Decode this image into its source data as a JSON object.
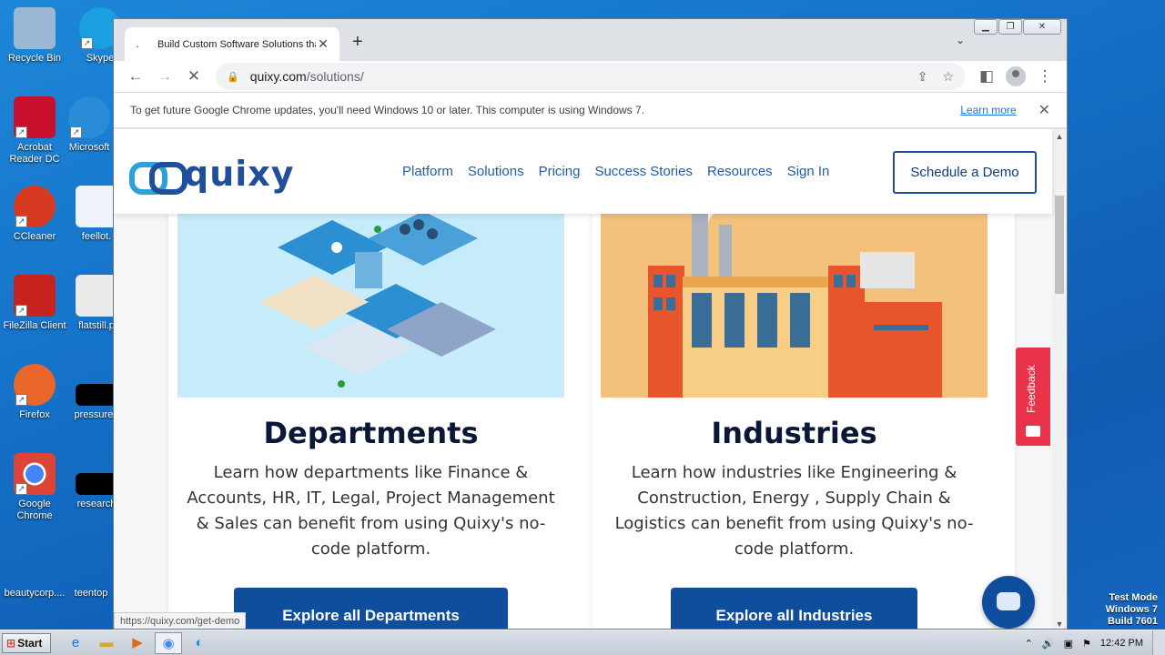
{
  "desktop": {
    "icons": [
      {
        "label": "Recycle Bin",
        "color": "#9bb7d4",
        "glyph": "🗑"
      },
      {
        "label": "Skype",
        "color": "#1a9fe0",
        "glyph": "S"
      },
      {
        "label": "Acrobat Reader DC",
        "color": "#c8102e",
        "glyph": "A"
      },
      {
        "label": "Microsoft",
        "color": "#2a8bd6",
        "glyph": "e"
      },
      {
        "label": "CCleaner",
        "color": "#d63b22",
        "glyph": "C"
      },
      {
        "label": "feellot.",
        "color": "#eef3fb",
        "glyph": "W"
      },
      {
        "label": "FileZilla Client",
        "color": "#c8221e",
        "glyph": "FZ"
      },
      {
        "label": "flatstill.p",
        "color": "#eaeaea",
        "glyph": ""
      },
      {
        "label": "Firefox",
        "color": "#e8662a",
        "glyph": "🦊"
      },
      {
        "label": "pressureb",
        "color": "#000000",
        "glyph": ""
      },
      {
        "label": "Google Chrome",
        "color": "#4285f4",
        "glyph": "◉"
      },
      {
        "label": "research",
        "color": "#000000",
        "glyph": ""
      },
      {
        "label": "beautycorp....",
        "color": "#1c6ec5",
        "glyph": ""
      },
      {
        "label": "teentop",
        "color": "#1c6ec5",
        "glyph": ""
      }
    ],
    "watermark": {
      "line1": "Test Mode",
      "line2": "Windows 7",
      "line3": "Build 7601"
    }
  },
  "browser": {
    "tab_title": "Build Custom Software Solutions tha",
    "new_tab": "+",
    "url_host": "quixy.com",
    "url_path": "/solutions/",
    "infobar": {
      "message": "To get future Google Chrome updates, you'll need Windows 10 or later. This computer is using Windows 7.",
      "link": "Learn more"
    },
    "status_url": "https://quixy.com/get-demo"
  },
  "site": {
    "logo": "quixy",
    "nav": [
      "Platform",
      "Solutions",
      "Pricing",
      "Success Stories",
      "Resources",
      "Sign In"
    ],
    "cta": "Schedule a Demo",
    "cards": [
      {
        "title": "Departments",
        "body": "Learn how departments like Finance & Accounts, HR, IT, Legal, Project Management & Sales can benefit from using Quixy's no-code platform.",
        "button": "Explore all Departments"
      },
      {
        "title": "Industries",
        "body": "Learn how industries like Engineering & Construction, Energy , Supply Chain & Logistics can benefit from using Quixy's no-code platform.",
        "button": "Explore all Industries"
      }
    ],
    "feedback": "Feedback"
  },
  "taskbar": {
    "start": "Start",
    "clock": "12:42 PM"
  },
  "colors": {
    "brand_blue": "#0f4e9d",
    "brand_light": "#2d9fd9",
    "feedback_red": "#e8334a"
  }
}
